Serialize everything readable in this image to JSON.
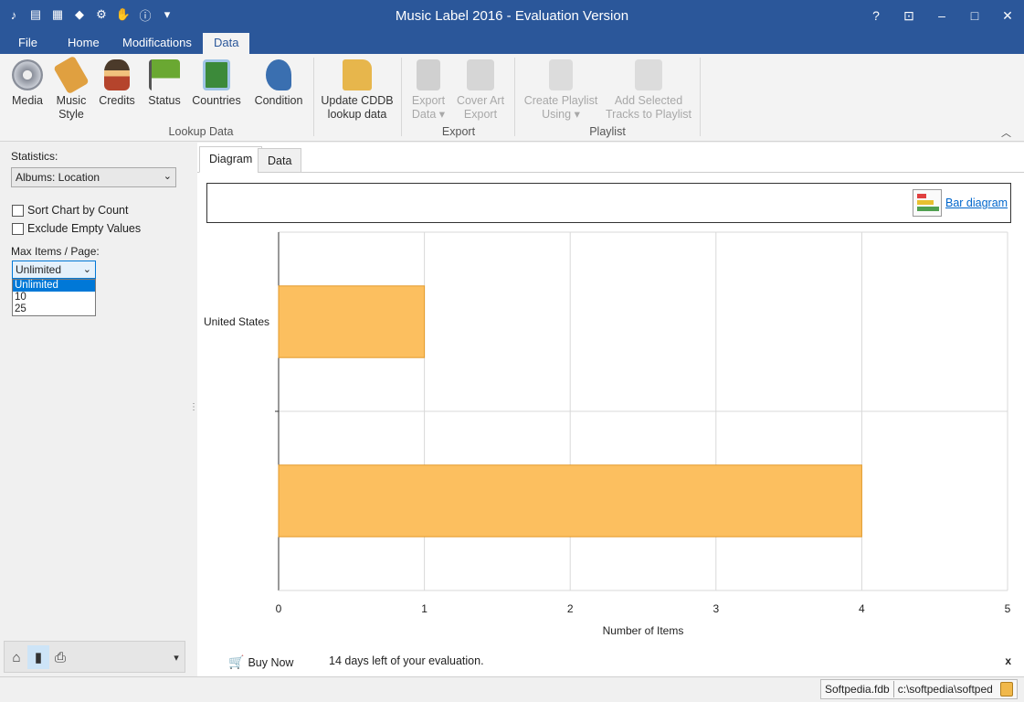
{
  "window": {
    "title": "Music Label 2016 - Evaluation Version",
    "controls": [
      "?",
      "⊡",
      "–",
      "□",
      "✕"
    ]
  },
  "quick_access": [
    "app-icon",
    "new-icon",
    "table-icon",
    "bookmark-icon",
    "gear-icon",
    "hand-icon",
    "info-icon",
    "dropdown-icon"
  ],
  "ribbon": {
    "tabs": [
      "File",
      "Home",
      "Modifications",
      "Data"
    ],
    "active_tab": "Data",
    "groups": {
      "lookup": "Lookup Data",
      "export": "Export",
      "playlist": "Playlist"
    },
    "buttons": {
      "media": "Media",
      "music_style_1": "Music",
      "music_style_2": "Style",
      "credits": "Credits",
      "status": "Status",
      "countries": "Countries",
      "condition": "Condition",
      "cddb_1": "Update CDDB",
      "cddb_2": "lookup data",
      "export_data_1": "Export",
      "export_data_2": "Data",
      "cover_art_1": "Cover Art",
      "cover_art_2": "Export",
      "create_playlist_1": "Create Playlist",
      "create_playlist_2": "Using",
      "add_selected_1": "Add Selected",
      "add_selected_2": "Tracks to Playlist"
    },
    "colors": {
      "title_bar": "#2b579a",
      "media": "#8a8f9a",
      "music_style": "#e0a040",
      "credits": "#b5442c",
      "status": "#6aa832",
      "countries": "#3c8a3a",
      "condition": "#3a6fb0",
      "cddb": "#e7b64c",
      "disabled": "#c8c8c8"
    }
  },
  "left_panel": {
    "statistics_label": "Statistics:",
    "statistics_value": "Albums: Location",
    "sort_chart": "Sort Chart by Count",
    "exclude_empty": "Exclude Empty Values",
    "max_items_label": "Max Items / Page:",
    "max_items_value": "Unlimited",
    "max_items_options": [
      "Unlimited",
      "10",
      "25"
    ],
    "footer_icons": [
      "home-icon",
      "bar-chart-icon",
      "print-icon",
      "dropdown-icon"
    ]
  },
  "content": {
    "tabs": [
      "Diagram",
      "Data"
    ],
    "active_tab": "Diagram",
    "bar_diagram_link": "Bar diagram",
    "buy_now": "Buy Now",
    "evaluation_text": "14 days left of your evaluation.",
    "close": "x"
  },
  "chart_data": {
    "type": "bar",
    "orientation": "horizontal",
    "categories": [
      "United States",
      ""
    ],
    "values": [
      1,
      4
    ],
    "xlabel": "Number of Items",
    "ylabel": "",
    "xlim": [
      0,
      5
    ],
    "xticks": [
      "0",
      "1",
      "2",
      "3",
      "4",
      "5"
    ],
    "grid": true,
    "bar_color": "#fcbf5f"
  },
  "status_bar": {
    "database": "Softpedia.fdb",
    "path": "c:\\softpedia\\softped"
  }
}
